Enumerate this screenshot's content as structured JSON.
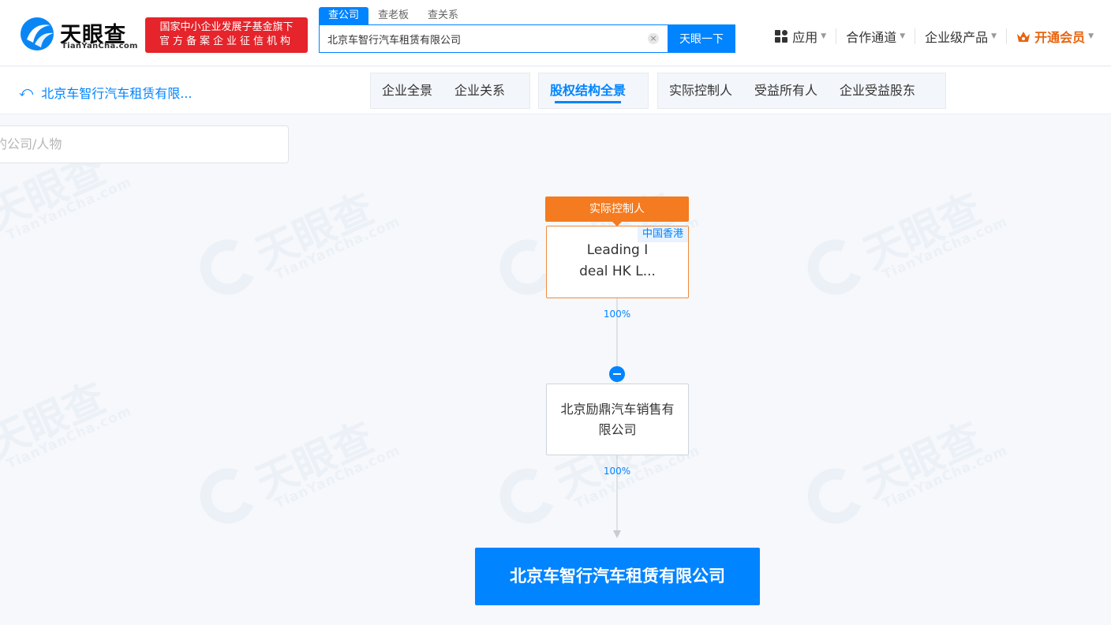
{
  "logo": {
    "name_cn": "天眼查",
    "name_en": "TianYanCha.com"
  },
  "gov_badge": {
    "line1": "国家中小企业发展子基金旗下",
    "line2": "官方备案企业征信机构"
  },
  "search": {
    "tabs": [
      "查公司",
      "查老板",
      "查关系"
    ],
    "value": "北京车智行汽车租赁有限公司",
    "button": "天眼一下"
  },
  "topnav": {
    "apps": "应用",
    "partner": "合作通道",
    "enterprise": "企业级产品",
    "vip": "开通会员"
  },
  "subbar": {
    "back_title": "北京车智行汽车租赁有限...",
    "tabs_left": [
      "企业全景",
      "企业关系"
    ],
    "tab_active": "股权结构全景",
    "tabs_right": [
      "实际控制人",
      "受益所有人",
      "企业受益股东"
    ]
  },
  "filter": {
    "placeholder": "的公司/人物"
  },
  "graph": {
    "controller_tag": "实际控制人",
    "controller": {
      "region": "中国香港",
      "name_line1": "Leading I",
      "name_line2": "deal HK L..."
    },
    "link1_pct": "100%",
    "middle": {
      "name_line1": "北京励鼎汽车销售有",
      "name_line2": "限公司"
    },
    "link2_pct": "100%",
    "target": "北京车智行汽车租赁有限公司"
  },
  "colors": {
    "brand_blue": "#0084ff",
    "controller_orange": "#f47b20",
    "badge_red": "#e5242b"
  }
}
